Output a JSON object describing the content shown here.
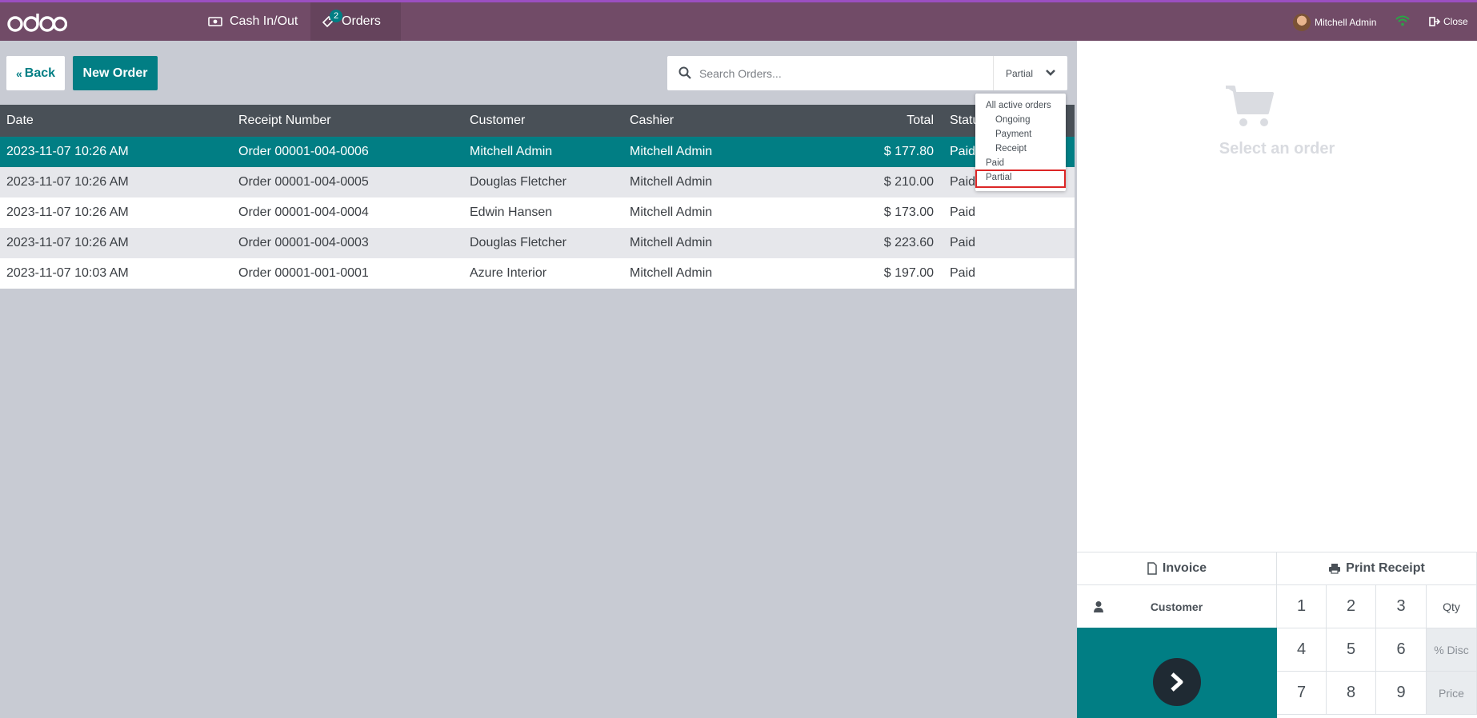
{
  "navbar": {
    "cash_label": "Cash In/Out",
    "orders_label": "Orders",
    "orders_badge": "2",
    "user_name": "Mitchell Admin",
    "close_label": "Close"
  },
  "actions": {
    "back_label": "Back",
    "new_order_label": "New Order"
  },
  "search": {
    "placeholder": "Search Orders...",
    "filter_value": "Partial"
  },
  "table": {
    "headers": [
      "Date",
      "Receipt Number",
      "Customer",
      "Cashier",
      "Total",
      "Status"
    ],
    "rows": [
      {
        "date": "2023-11-07 10:26 AM",
        "receipt": "Order 00001-004-0006",
        "customer": "Mitchell Admin",
        "cashier": "Mitchell Admin",
        "total": "$ 177.80",
        "status": "Paid"
      },
      {
        "date": "2023-11-07 10:26 AM",
        "receipt": "Order 00001-004-0005",
        "customer": "Douglas Fletcher",
        "cashier": "Mitchell Admin",
        "total": "$ 210.00",
        "status": "Paid"
      },
      {
        "date": "2023-11-07 10:26 AM",
        "receipt": "Order 00001-004-0004",
        "customer": "Edwin Hansen",
        "cashier": "Mitchell Admin",
        "total": "$ 173.00",
        "status": "Paid"
      },
      {
        "date": "2023-11-07 10:26 AM",
        "receipt": "Order 00001-004-0003",
        "customer": "Douglas Fletcher",
        "cashier": "Mitchell Admin",
        "total": "$ 223.60",
        "status": "Paid"
      },
      {
        "date": "2023-11-07 10:03 AM",
        "receipt": "Order 00001-001-0001",
        "customer": "Azure Interior",
        "cashier": "Mitchell Admin",
        "total": "$ 197.00",
        "status": "Paid"
      }
    ]
  },
  "filter_menu": {
    "items": [
      "All active orders",
      "Ongoing",
      "Payment",
      "Receipt",
      "Paid",
      "Partial"
    ]
  },
  "right_panel": {
    "empty_text": "Select an order",
    "invoice_label": "Invoice",
    "print_label": "Print Receipt",
    "customer_label": "Customer",
    "keys": [
      "1",
      "2",
      "3",
      "Qty",
      "4",
      "5",
      "6",
      "% Disc",
      "7",
      "8",
      "9",
      "Price"
    ]
  },
  "colors": {
    "brand": "#714b67",
    "accent": "#017e84",
    "header": "#495057",
    "highlight": "#dc2626"
  }
}
